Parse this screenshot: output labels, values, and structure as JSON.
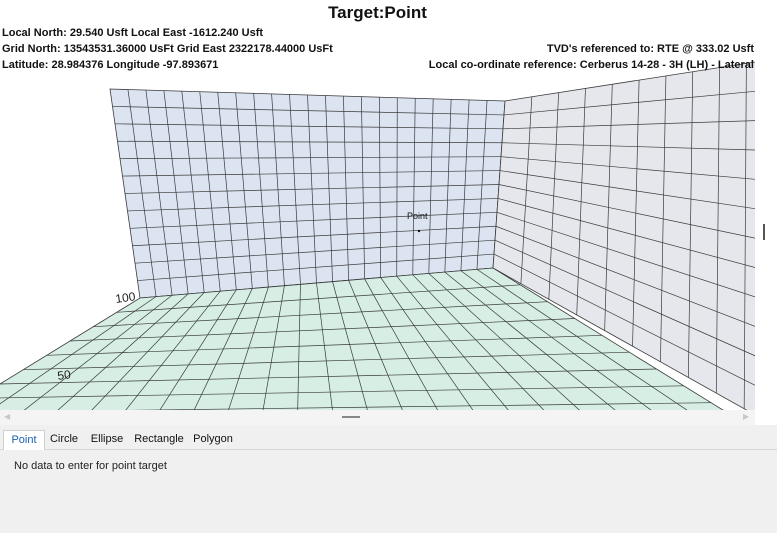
{
  "plot": {
    "title": "Target:Point",
    "local_north_east": "Local North: 29.540 Usft Local East -1612.240 Usft",
    "grid_north_east": "Grid North: 13543531.36000 UsFt Grid East 2322178.44000 UsFt",
    "lat_long": "Latitude: 28.984376 Longitude -97.893671",
    "tvd_reference": "TVD's referenced to: RTE @ 333.02 Usft",
    "local_reference": "Local co-ordinate reference: Cerberus 14-28 - 3H (LH) - Lateral",
    "point_label": "Point",
    "axis_ticks": [
      "100",
      "50"
    ],
    "colors": {
      "back_wall": "#dce4f2",
      "side_wall": "#e6e7ec",
      "floor": "#d6eee4",
      "grid_line": "#3a3a3a"
    }
  },
  "tabs": [
    {
      "label": "Point",
      "active": true
    },
    {
      "label": "Circle",
      "active": false
    },
    {
      "label": "Ellipse",
      "active": false
    },
    {
      "label": "Rectangle",
      "active": false
    },
    {
      "label": "Polygon",
      "active": false
    }
  ],
  "content": {
    "message": "No data to enter for point target"
  },
  "scrollbars": {
    "left_arrow_icon": "triangle-left",
    "right_arrow_icon": "triangle-right",
    "grip_icon": "grip-lines"
  }
}
